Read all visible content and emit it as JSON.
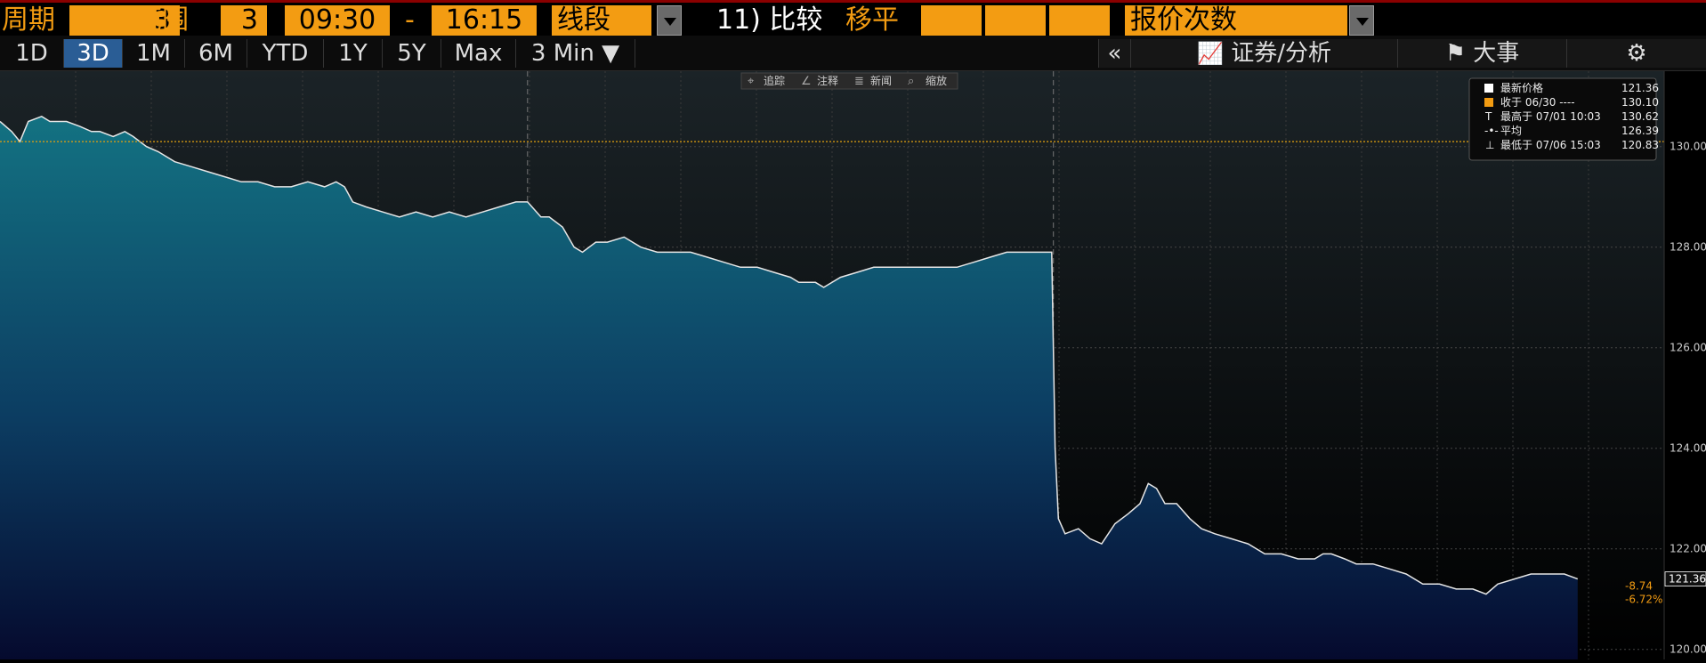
{
  "toolbar": {
    "period_label": "周期",
    "period_value": "3",
    "range_label": "范围",
    "range_value": "3",
    "time_from": "09:30",
    "dash": "-",
    "time_to": "16:15",
    "line_type": "线段",
    "compare_label": "11) 比较",
    "moving_avg": "移平",
    "volume_label": "报价次数"
  },
  "ranges": [
    {
      "label": "1D",
      "active": false
    },
    {
      "label": "3D",
      "active": true
    },
    {
      "label": "1M",
      "active": false
    },
    {
      "label": "6M",
      "active": false
    },
    {
      "label": "YTD",
      "active": false
    },
    {
      "label": "1Y",
      "active": false
    },
    {
      "label": "5Y",
      "active": false
    },
    {
      "label": "Max",
      "active": false
    },
    {
      "label": "3 Min ▼",
      "active": false
    }
  ],
  "right_buttons": {
    "collapse": "«",
    "securities": "证券/分析",
    "events": "大事"
  },
  "chart_tools": [
    "追踪",
    "注释",
    "新闻",
    "缩放"
  ],
  "legend": [
    {
      "label": "最新价格",
      "value": "121.36"
    },
    {
      "label": "收于 06/30 ----",
      "value": "130.10"
    },
    {
      "label": "最高于 07/01 10:03",
      "value": "130.62"
    },
    {
      "label": "平均",
      "value": "126.39"
    },
    {
      "label": "最低于 07/06 15:03",
      "value": "120.83"
    }
  ],
  "labels": {
    "last_price": "121.36",
    "change": "-8.74",
    "change_pct": "-6.72%"
  },
  "colors": {
    "accent_orange": "#f39c12",
    "active_tab": "#2a5d95",
    "area_top": "#137282",
    "area_bottom": "#050a2e",
    "line": "#e6e6e6",
    "close_line": "#e3a00f"
  },
  "chart_data": {
    "type": "area",
    "ylim": [
      119.8,
      131.5
    ],
    "yticks": [
      "120.00",
      "122.00",
      "124.00",
      "126.00",
      "128.00",
      "130.00"
    ],
    "ytick_values": [
      120,
      122,
      124,
      126,
      128,
      130
    ],
    "reference_line": 130.1,
    "session_breaks": [
      0.317,
      0.633
    ],
    "series": [
      {
        "values": [
          [
            0.0,
            130.5
          ],
          [
            0.007,
            130.3
          ],
          [
            0.012,
            130.1
          ],
          [
            0.017,
            130.5
          ],
          [
            0.025,
            130.6
          ],
          [
            0.03,
            130.5
          ],
          [
            0.04,
            130.5
          ],
          [
            0.048,
            130.4
          ],
          [
            0.055,
            130.3
          ],
          [
            0.06,
            130.3
          ],
          [
            0.068,
            130.2
          ],
          [
            0.075,
            130.3
          ],
          [
            0.08,
            130.2
          ],
          [
            0.088,
            130.0
          ],
          [
            0.095,
            129.9
          ],
          [
            0.105,
            129.7
          ],
          [
            0.115,
            129.6
          ],
          [
            0.125,
            129.5
          ],
          [
            0.135,
            129.4
          ],
          [
            0.145,
            129.3
          ],
          [
            0.155,
            129.3
          ],
          [
            0.165,
            129.2
          ],
          [
            0.175,
            129.2
          ],
          [
            0.185,
            129.3
          ],
          [
            0.195,
            129.2
          ],
          [
            0.202,
            129.3
          ],
          [
            0.207,
            129.2
          ],
          [
            0.212,
            128.9
          ],
          [
            0.22,
            128.8
          ],
          [
            0.23,
            128.7
          ],
          [
            0.24,
            128.6
          ],
          [
            0.25,
            128.7
          ],
          [
            0.26,
            128.6
          ],
          [
            0.27,
            128.7
          ],
          [
            0.28,
            128.6
          ],
          [
            0.29,
            128.7
          ],
          [
            0.3,
            128.8
          ],
          [
            0.31,
            128.9
          ],
          [
            0.317,
            128.9
          ],
          [
            0.325,
            128.6
          ],
          [
            0.33,
            128.6
          ],
          [
            0.338,
            128.4
          ],
          [
            0.345,
            128.0
          ],
          [
            0.35,
            127.9
          ],
          [
            0.358,
            128.1
          ],
          [
            0.365,
            128.1
          ],
          [
            0.375,
            128.2
          ],
          [
            0.385,
            128.0
          ],
          [
            0.395,
            127.9
          ],
          [
            0.405,
            127.9
          ],
          [
            0.415,
            127.9
          ],
          [
            0.425,
            127.8
          ],
          [
            0.435,
            127.7
          ],
          [
            0.445,
            127.6
          ],
          [
            0.455,
            127.6
          ],
          [
            0.465,
            127.5
          ],
          [
            0.475,
            127.4
          ],
          [
            0.48,
            127.3
          ],
          [
            0.49,
            127.3
          ],
          [
            0.495,
            127.2
          ],
          [
            0.505,
            127.4
          ],
          [
            0.515,
            127.5
          ],
          [
            0.525,
            127.6
          ],
          [
            0.535,
            127.6
          ],
          [
            0.545,
            127.6
          ],
          [
            0.555,
            127.6
          ],
          [
            0.565,
            127.6
          ],
          [
            0.575,
            127.6
          ],
          [
            0.585,
            127.7
          ],
          [
            0.595,
            127.8
          ],
          [
            0.605,
            127.9
          ],
          [
            0.615,
            127.9
          ],
          [
            0.625,
            127.9
          ],
          [
            0.632,
            127.9
          ],
          [
            0.634,
            124.0
          ],
          [
            0.636,
            122.6
          ],
          [
            0.64,
            122.3
          ],
          [
            0.648,
            122.4
          ],
          [
            0.655,
            122.2
          ],
          [
            0.662,
            122.1
          ],
          [
            0.67,
            122.5
          ],
          [
            0.678,
            122.7
          ],
          [
            0.685,
            122.9
          ],
          [
            0.69,
            123.3
          ],
          [
            0.695,
            123.2
          ],
          [
            0.7,
            122.9
          ],
          [
            0.707,
            122.9
          ],
          [
            0.715,
            122.6
          ],
          [
            0.722,
            122.4
          ],
          [
            0.73,
            122.3
          ],
          [
            0.74,
            122.2
          ],
          [
            0.75,
            122.1
          ],
          [
            0.76,
            121.9
          ],
          [
            0.77,
            121.9
          ],
          [
            0.78,
            121.8
          ],
          [
            0.79,
            121.8
          ],
          [
            0.795,
            121.9
          ],
          [
            0.8,
            121.9
          ],
          [
            0.808,
            121.8
          ],
          [
            0.815,
            121.7
          ],
          [
            0.825,
            121.7
          ],
          [
            0.835,
            121.6
          ],
          [
            0.845,
            121.5
          ],
          [
            0.855,
            121.3
          ],
          [
            0.865,
            121.3
          ],
          [
            0.875,
            121.2
          ],
          [
            0.885,
            121.2
          ],
          [
            0.893,
            121.1
          ],
          [
            0.9,
            121.3
          ],
          [
            0.91,
            121.4
          ],
          [
            0.92,
            121.5
          ],
          [
            0.93,
            121.5
          ],
          [
            0.94,
            121.5
          ],
          [
            0.948,
            121.4
          ]
        ]
      }
    ]
  }
}
